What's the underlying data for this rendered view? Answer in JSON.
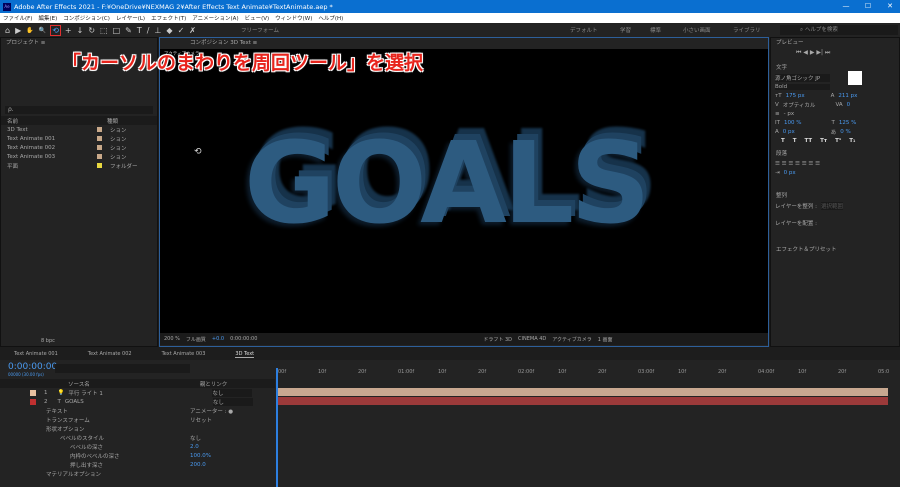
{
  "window": {
    "title": "Adobe After Effects 2021 - F:¥OneDrive¥NEXMAG 2¥After Effects Text Animate¥TextAnimate.aep *",
    "minimize": "—",
    "maximize": "☐",
    "close": "✕"
  },
  "menu": [
    "ファイル(F)",
    "編集(E)",
    "コンポジション(C)",
    "レイヤー(L)",
    "エフェクト(T)",
    "アニメーション(A)",
    "ビュー(V)",
    "ウィンドウ(W)",
    "ヘルプ(H)"
  ],
  "toolbar": {
    "tools": [
      "⌂",
      "▶",
      "✋",
      "🔍"
    ],
    "selected_tool": "⟲",
    "tools2": [
      "+",
      "↓",
      "↻",
      "⬚",
      "□",
      "✎",
      "T",
      "/",
      "⊥",
      "◆",
      "✓",
      "✗"
    ],
    "freeform": "フリーフォーム"
  },
  "workspaces": [
    "デフォルト",
    "学習",
    "標準",
    "小さい画面",
    "ライブラリ"
  ],
  "help_search": "ヘルプを検索",
  "callout": "「カーソルのまわりを周回ツール」を選択",
  "project": {
    "title": "プロジェクト ≡",
    "search_placeholder": "ρ.",
    "col_name": "名前",
    "col_type": "種類",
    "items": [
      {
        "name": "3D Text",
        "type": "ション"
      },
      {
        "name": "Text Animate 001",
        "type": "ション"
      },
      {
        "name": "Text Animate 002",
        "type": "ション"
      },
      {
        "name": "Text Animate 003",
        "type": "ション"
      },
      {
        "name": "平面",
        "type": "フォルダー"
      }
    ],
    "bpc": "8 bpc"
  },
  "comp": {
    "title": "コンポジション 3D Text ≡",
    "camera_label": "アクティブカメラ",
    "viewer_text": "GOALS",
    "zoom": "200 %",
    "quality": "フル画質",
    "exposure": "+0.0",
    "timecode": "0:00:00:00",
    "draft": "ドラフト 3D",
    "renderer": "CINEMA 4D",
    "camera": "アクティブカメラ",
    "views": "1 画面"
  },
  "right": {
    "preview": "プレビュー",
    "character": "文字",
    "font": "源ノ角ゴシック JP",
    "style": "Bold",
    "size": "175 px",
    "leading": "211 px",
    "kerning": "オプティカル",
    "tracking": "0",
    "stroke": "- px",
    "vscale": "100 %",
    "hscale": "125 %",
    "baseline": "0 px",
    "tsume": "0 %",
    "type_styles": [
      "T",
      "T",
      "TT",
      "Tт",
      "T¹",
      "T₁"
    ],
    "paragraph": "段落",
    "indent": "0 px",
    "align": "整列",
    "align_to": "レイヤーを整列 :",
    "align_sel": "選択範囲",
    "distribute": "レイヤーを配置 :",
    "effects": "エフェクト＆プリセット"
  },
  "timeline": {
    "tabs": [
      "Text Animate 001",
      "Text Animate 002",
      "Text Animate 003",
      "3D Text"
    ],
    "timecode": "0:00:00:00",
    "fps": "00000 (30.00 fps)",
    "col_source": "ソース名",
    "col_parent": "親とリンク",
    "ruler": [
      "00f",
      "10f",
      "20f",
      "01:00f",
      "10f",
      "20f",
      "02:00f",
      "10f",
      "20f",
      "03:00f",
      "10f",
      "20f",
      "04:00f",
      "10f",
      "20f",
      "05:0"
    ],
    "layers": [
      {
        "num": "1",
        "name": "平行 ライト 1",
        "parent": "なし",
        "color": "#e8c0a0"
      },
      {
        "num": "2",
        "name": "GOALS",
        "parent": "なし",
        "color": "#c03030"
      }
    ],
    "props": [
      {
        "name": "テキスト",
        "value": "アニメーター : ●"
      },
      {
        "name": "トランスフォーム",
        "value": "リセット"
      },
      {
        "name": "形状オプション",
        "value": ""
      },
      {
        "name": "ベベルのスタイル",
        "value": "なし"
      },
      {
        "name": "ベベルの深さ",
        "value": "2.0"
      },
      {
        "name": "内枠のベベルの深さ",
        "value": "100.0%"
      },
      {
        "name": "押し出す深さ",
        "value": "200.0"
      },
      {
        "name": "マテリアルオプション",
        "value": ""
      }
    ]
  }
}
